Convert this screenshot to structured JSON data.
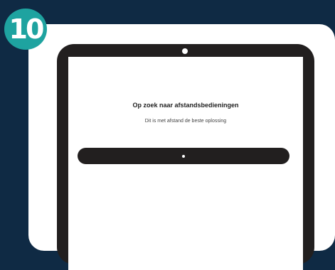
{
  "step": {
    "number": "10"
  },
  "screen": {
    "title": "Op zoek naar afstandsbedieningen",
    "subtitle": "Dit is met afstand de beste oplossing"
  },
  "colors": {
    "background": "#0f2a44",
    "badge": "#1ea3a0",
    "tablet": "#221f1f",
    "card": "#ffffff"
  },
  "icons": {
    "camera": "camera-icon",
    "progress": "loading-dot-icon"
  }
}
